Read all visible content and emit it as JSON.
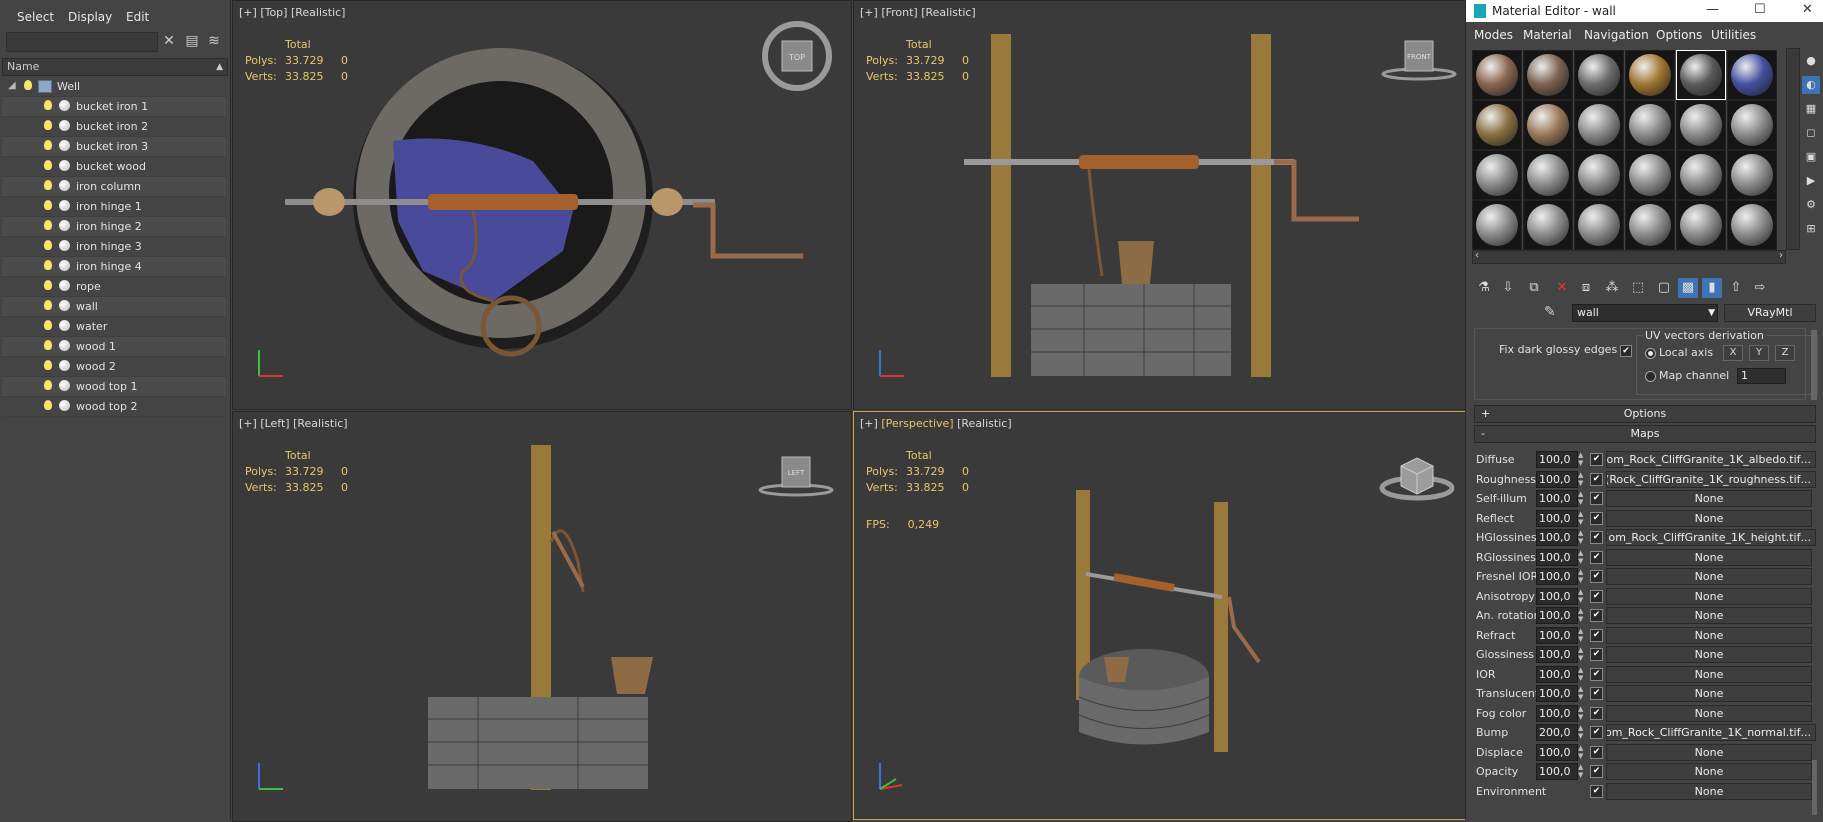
{
  "explorer": {
    "menu": [
      "Select",
      "Display",
      "Edit"
    ],
    "column_name": "Name",
    "root": "Well",
    "items": [
      "bucket iron 1",
      "bucket iron 2",
      "bucket iron 3",
      "bucket wood",
      "iron column",
      "iron hinge 1",
      "iron hinge 2",
      "iron hinge 3",
      "iron hinge 4",
      "rope",
      "wall",
      "water",
      "wood 1",
      "wood 2",
      "wood top 1",
      "wood top 2"
    ]
  },
  "viewports": [
    {
      "plus": "[+]",
      "name": "[Top]",
      "shading": "[Realistic]",
      "cube_label": "TOP"
    },
    {
      "plus": "[+]",
      "name": "[Front]",
      "shading": "[Realistic]",
      "cube_label": "FRONT"
    },
    {
      "plus": "[+]",
      "name": "[Left]",
      "shading": "[Realistic]",
      "cube_label": "LEFT"
    },
    {
      "plus": "[+]",
      "name": "[Perspective]",
      "shading": "[Realistic]",
      "cube_label": ""
    }
  ],
  "stats": {
    "total_label": "Total",
    "polys_label": "Polys:",
    "polys_value": "33.729",
    "polys_sel": "0",
    "verts_label": "Verts:",
    "verts_value": "33.825",
    "verts_sel": "0",
    "fps_label": "FPS:",
    "fps_value": "0,249"
  },
  "material_editor": {
    "title": "Material Editor - wall",
    "window_controls": [
      "—",
      "☐",
      "✕"
    ],
    "menu": [
      "Modes",
      "Material",
      "Navigation",
      "Options",
      "Utilities"
    ],
    "material_name": "wall",
    "material_type": "VRayMtl",
    "fix_dark_glossy": "Fix dark glossy edges",
    "uv_title": "UV vectors derivation",
    "local_axis": "Local axis",
    "axes": [
      "X",
      "Y",
      "Z"
    ],
    "map_channel": "Map channel",
    "map_channel_value": "1",
    "options_rollout": "Options",
    "maps_rollout": "Maps",
    "maps": [
      {
        "name": "Diffuse",
        "value": "100,0",
        "checked": true,
        "map": "...om_Rock_CliffGranite_1K_albedo.tif)"
      },
      {
        "name": "Roughness",
        "value": "100,0",
        "checked": true,
        "map": "...Rock_CliffGranite_1K_roughness.tif)"
      },
      {
        "name": "Self-illum",
        "value": "100,0",
        "checked": true,
        "map": "None"
      },
      {
        "name": "Reflect",
        "value": "100,0",
        "checked": true,
        "map": "None"
      },
      {
        "name": "HGlossiness",
        "value": "100,0",
        "checked": true,
        "map": "...om_Rock_CliffGranite_1K_height.tif)"
      },
      {
        "name": "RGlossiness",
        "value": "100,0",
        "checked": true,
        "map": "None"
      },
      {
        "name": "Fresnel IOR",
        "value": "100,0",
        "checked": true,
        "map": "None"
      },
      {
        "name": "Anisotropy",
        "value": "100,0",
        "checked": true,
        "map": "None"
      },
      {
        "name": "An. rotation",
        "value": "100,0",
        "checked": true,
        "map": "None"
      },
      {
        "name": "Refract",
        "value": "100,0",
        "checked": true,
        "map": "None"
      },
      {
        "name": "Glossiness",
        "value": "100,0",
        "checked": true,
        "map": "None"
      },
      {
        "name": "IOR",
        "value": "100,0",
        "checked": true,
        "map": "None"
      },
      {
        "name": "Translucent",
        "value": "100,0",
        "checked": true,
        "map": "None"
      },
      {
        "name": "Fog color",
        "value": "100,0",
        "checked": true,
        "map": "None"
      },
      {
        "name": "Bump",
        "value": "200,0",
        "checked": true,
        "map": "...om_Rock_CliffGranite_1K_normal.tif)"
      },
      {
        "name": "Displace",
        "value": "100,0",
        "checked": true,
        "map": "None"
      },
      {
        "name": "Opacity",
        "value": "100,0",
        "checked": true,
        "map": "None"
      },
      {
        "name": "Environment",
        "value": "",
        "checked": true,
        "map": "None"
      }
    ],
    "slot_colors": [
      "#8a6450",
      "#7a6250",
      "#6c6c6c",
      "#a07530",
      "#5a5a5a",
      "#4450a0",
      "#8a7040",
      "#9a7a5a"
    ]
  }
}
